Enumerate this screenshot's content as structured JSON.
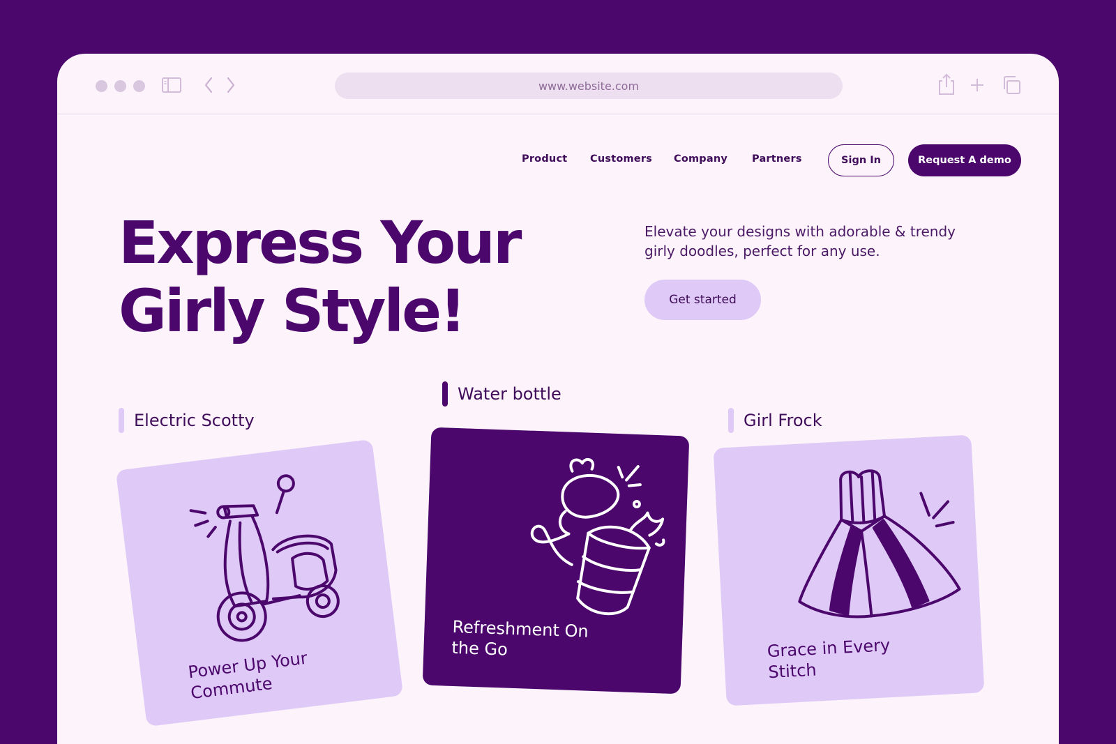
{
  "browser": {
    "url": "www.website.com"
  },
  "nav": {
    "links": [
      "Product",
      "Customers",
      "Company",
      "Partners"
    ],
    "sign_in": "Sign In",
    "request_demo": "Request A demo"
  },
  "hero": {
    "title_line1": "Express Your",
    "title_line2": "Girly Style!",
    "description": "Elevate your designs with adorable & trendy girly doodles, perfect for any use.",
    "cta": "Get started"
  },
  "cards": [
    {
      "category": "Electric Scotty",
      "caption_line1": "Power Up Your",
      "caption_line2": "Commute",
      "icon": "scooter-icon"
    },
    {
      "category": "Water bottle",
      "caption_line1": "Refreshment On",
      "caption_line2": "the Go",
      "icon": "water-bottle-icon"
    },
    {
      "category": "Girl Frock",
      "caption_line1": "Grace in Every",
      "caption_line2": "Stitch",
      "icon": "dress-icon"
    }
  ],
  "colors": {
    "background": "#4b076c",
    "page": "#fdf3fb",
    "accent_light": "#dfc9f6",
    "accent_dark": "#4b076c"
  }
}
